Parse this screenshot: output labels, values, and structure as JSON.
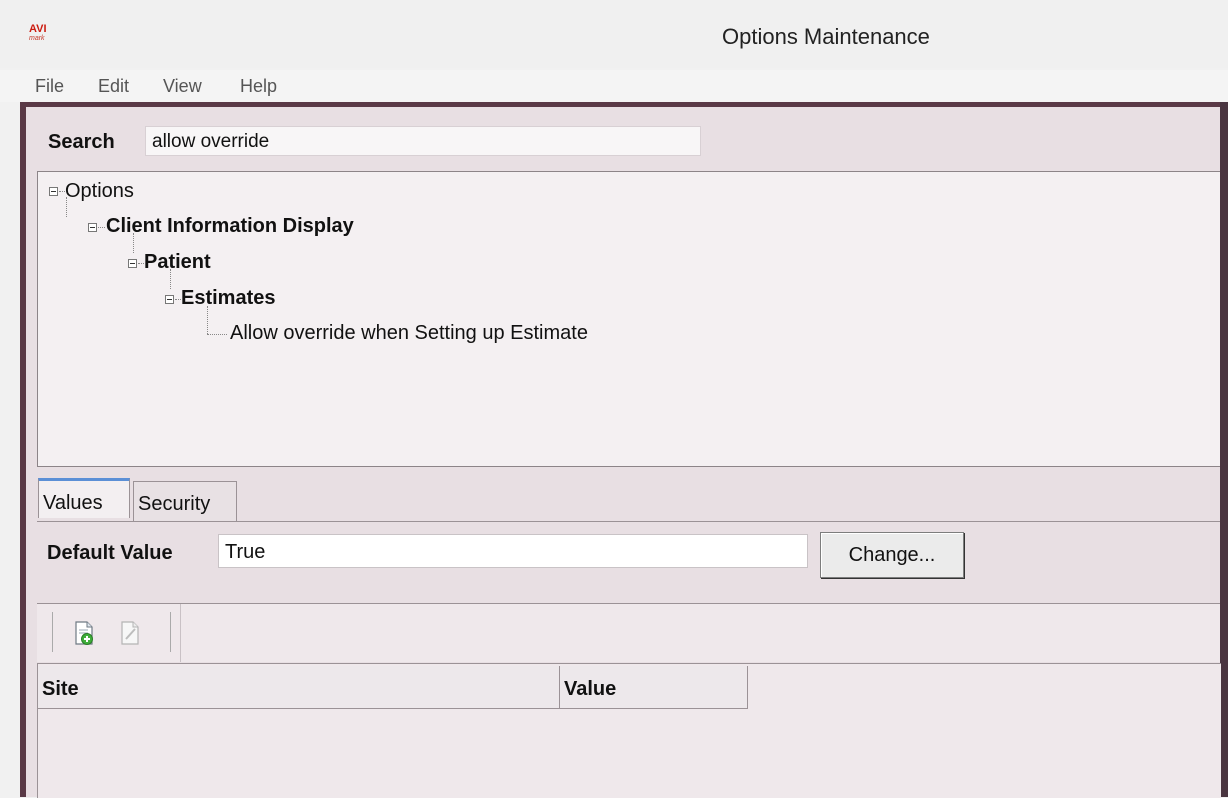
{
  "window": {
    "title": "Options Maintenance",
    "logo_text": "AVI",
    "logo_subtext": "mark"
  },
  "menu": {
    "items": [
      "File",
      "Edit",
      "View",
      "Help"
    ]
  },
  "search": {
    "label": "Search",
    "value": "allow override"
  },
  "tree": {
    "root": "Options",
    "level1": "Client Information Display",
    "level2": "Patient",
    "level3": "Estimates",
    "leaf": "Allow override when Setting up Estimate"
  },
  "tabs": {
    "items": [
      "Values",
      "Security"
    ],
    "active": "Values"
  },
  "values_tab": {
    "default_value_label": "Default Value",
    "default_value": "True",
    "change_button": "Change..."
  },
  "grid": {
    "columns": [
      "Site",
      "Value"
    ],
    "rows": []
  },
  "colors": {
    "frame": "#5a3946",
    "panel_bg": "#e8dfe3",
    "active_tab_accent": "#5b8fd6"
  }
}
